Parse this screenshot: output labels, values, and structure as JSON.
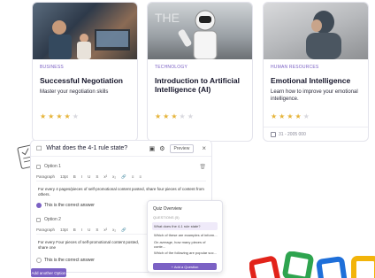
{
  "cards": [
    {
      "category": "BUSINESS",
      "title": "Successful Negotiation",
      "description": "Master your negotiation skills",
      "rating": 4,
      "max_rating": 5
    },
    {
      "category": "TECHNOLOGY",
      "title": "Introduction to Artificial Intelligence (AI)",
      "description": "",
      "rating": 3,
      "max_rating": 5
    },
    {
      "category": "HUMAN RESOURCES",
      "title": "Emotional Intelligence",
      "description": "Learn how to improve your emotional intelligence.",
      "rating": 4,
      "max_rating": 5,
      "footer": "31 - 2005 000"
    }
  ],
  "quiz": {
    "question": "What does the 4-1 rule state?",
    "preview_button": "Preview",
    "options": [
      {
        "label": "Option 1",
        "toolbar": [
          "Paragraph",
          "13pt",
          "B",
          "I",
          "U",
          "S",
          "x²",
          "x₂",
          "🔗",
          "≡",
          "≡"
        ],
        "body": "For every 4 pages/pieces of self-promotional content posted, share four pieces of content from others.",
        "correct_label": "This is the correct answer",
        "correct": true
      },
      {
        "label": "Option 2",
        "toolbar": [
          "Paragraph",
          "13pt",
          "B",
          "I",
          "U",
          "S",
          "x²",
          "x₂",
          "🔗",
          "≡",
          "≡"
        ],
        "body": "For every Four pieces of self-promotional content posted, share one",
        "correct_label": "This is the correct answer",
        "correct": false
      }
    ],
    "add_button": "Add another Option"
  },
  "overview": {
    "title": "Quiz Overview",
    "subtitle": "QUESTIONS (5)",
    "items": [
      "What does the 4-1 rule state?",
      "Which of these are examples of inform...",
      "On average, how many pieces of conte...",
      "Which of the following are popular soc..."
    ],
    "add_button": "+ Add a Question"
  }
}
